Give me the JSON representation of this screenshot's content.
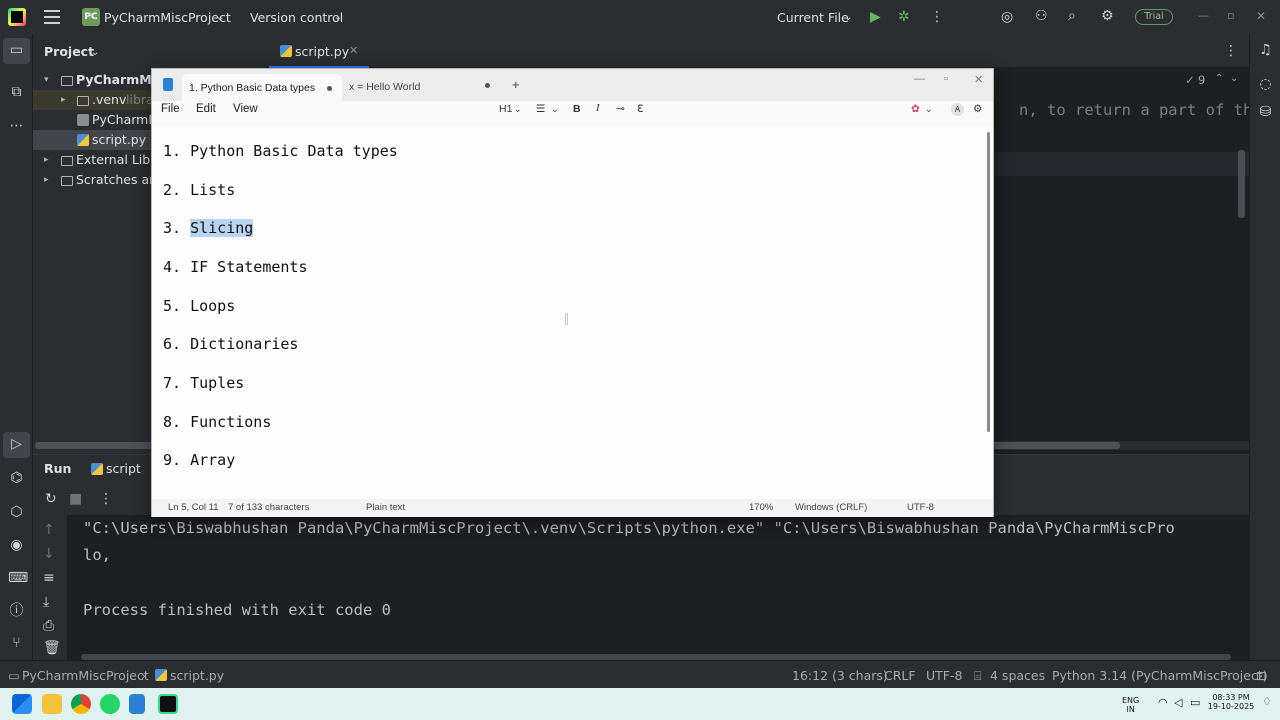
{
  "ide": {
    "project_badge": "PC",
    "project_name": "PyCharmMiscProject",
    "version_control": "Version control",
    "run_config": "Current File",
    "trial_label": "Trial"
  },
  "project_panel": {
    "title": "Project",
    "items": [
      {
        "label": "PyCharmMis"
      },
      {
        "label": ".venv",
        "suffix": "librar"
      },
      {
        "label": "PyCharmM"
      },
      {
        "label": "script.py"
      },
      {
        "label": "External Libra"
      },
      {
        "label": "Scratches and"
      }
    ]
  },
  "editor": {
    "tab_label": "script.py",
    "code_fragment": "n, to return a part of the",
    "problems_count": "9"
  },
  "run_panel": {
    "title": "Run",
    "config": "script",
    "console": [
      "\"C:\\Users\\Biswabhushan Panda\\PyCharmMiscProject\\.venv\\Scripts\\python.exe\" \"C:\\Users\\Biswabhushan Panda\\PyCharmMiscPro",
      "lo,",
      "",
      "Process finished with exit code 0"
    ]
  },
  "status_bar": {
    "breadcrumb_project": "PyCharmMiscProject",
    "breadcrumb_file": "script.py",
    "position": "16:12 (3 chars)",
    "line_ending": "CRLF",
    "encoding": "UTF-8",
    "indent": "4 spaces",
    "interpreter": "Python 3.14 (PyCharmMiscProject)"
  },
  "notepad": {
    "tabs": [
      {
        "label": "1. Python Basic Data types"
      },
      {
        "label": "x = Hello World"
      }
    ],
    "menu": {
      "file": "File",
      "edit": "Edit",
      "view": "View"
    },
    "toolbar": {
      "heading": "H1",
      "bold": "B",
      "italic": "I",
      "account": "A"
    },
    "lines": [
      {
        "num": "1.",
        "text": "Python Basic Data types"
      },
      {
        "num": "2.",
        "text": "Lists"
      },
      {
        "num": "3.",
        "text": "Slicing"
      },
      {
        "num": "4.",
        "text": "IF Statements"
      },
      {
        "num": "5.",
        "text": "Loops"
      },
      {
        "num": "6.",
        "text": "Dictionaries"
      },
      {
        "num": "7.",
        "text": "Tuples"
      },
      {
        "num": "8.",
        "text": "Functions"
      },
      {
        "num": "9.",
        "text": "Array"
      }
    ],
    "status": {
      "position": "Ln 5, Col 11",
      "chars": "7 of 133 characters",
      "format": "Plain text",
      "zoom": "170%",
      "line_ending": "Windows (CRLF)",
      "encoding": "UTF-8"
    }
  },
  "taskbar": {
    "lang_top": "ENG",
    "lang_bottom": "IN",
    "time": "08:33 PM",
    "date": "19-10-2025"
  },
  "colors": {
    "ide_bg": "#1e1f22",
    "ide_panel": "#2b2d30",
    "accent": "#3574f0",
    "selection_highlight": "#b8d4f0",
    "taskbar": "#dff2ee"
  }
}
